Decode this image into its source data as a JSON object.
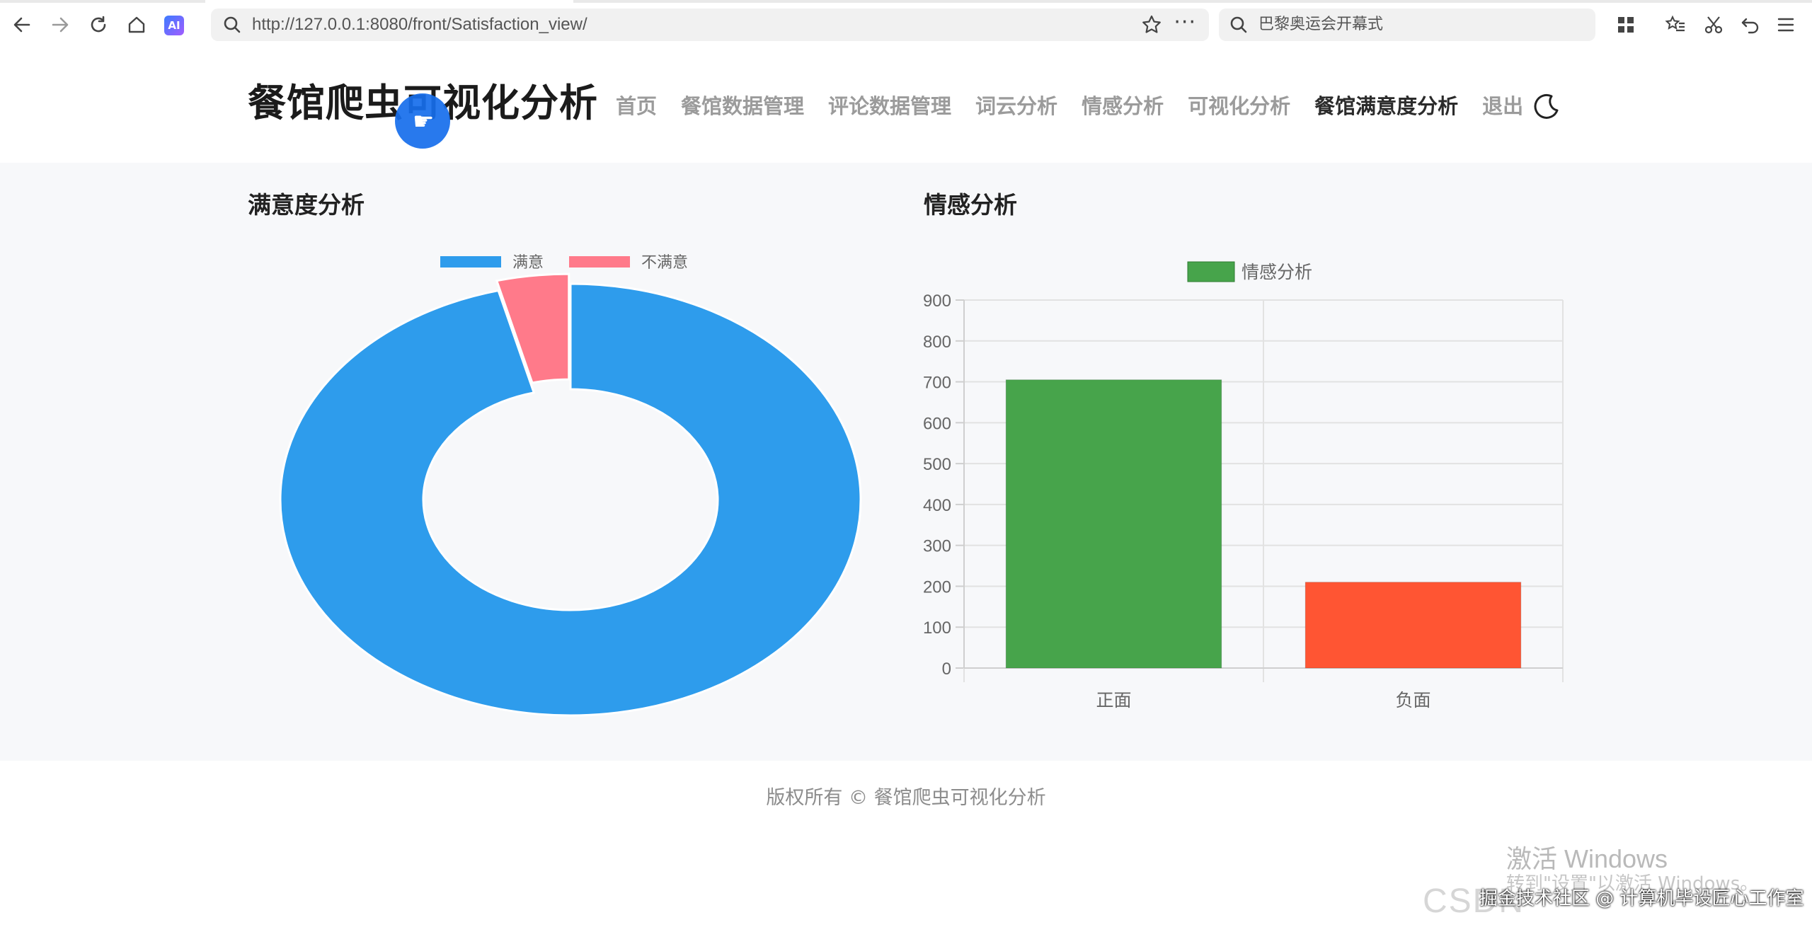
{
  "browser": {
    "address_url": "http://127.0.0.1:8080/front/Satisfaction_view/",
    "search_text": "巴黎奥运会开幕式",
    "ai_badge": "AI",
    "more_label": "···"
  },
  "header": {
    "title": "餐馆爬虫可视化分析",
    "nav": [
      {
        "label": "首页"
      },
      {
        "label": "餐馆数据管理"
      },
      {
        "label": "评论数据管理"
      },
      {
        "label": "词云分析"
      },
      {
        "label": "情感分析"
      },
      {
        "label": "可视化分析"
      },
      {
        "label": "餐馆满意度分析"
      },
      {
        "label": "退出"
      }
    ],
    "active_nav": "餐馆满意度分析"
  },
  "main": {
    "satisfaction_title": "满意度分析",
    "sentiment_title": "情感分析"
  },
  "chart_data": [
    {
      "type": "pie",
      "title": "满意度分析",
      "legend_position": "top",
      "categories": [
        "满意",
        "不满意"
      ],
      "values": [
        96,
        4
      ],
      "colors": [
        "#2e9cec",
        "#ff7a8a"
      ],
      "donut": true
    },
    {
      "type": "bar",
      "title": "情感分析",
      "legend_position": "top",
      "categories": [
        "正面",
        "负面"
      ],
      "series": [
        {
          "name": "情感分析",
          "values": [
            705,
            210
          ]
        }
      ],
      "bar_colors": [
        "#47a44b",
        "#ff5533"
      ],
      "legend_color": "#47a44b",
      "ylim": [
        0,
        900
      ],
      "yticks": [
        0,
        100,
        200,
        300,
        400,
        500,
        600,
        700,
        800,
        900
      ],
      "grid": true
    }
  ],
  "footer": {
    "copyright": "版权所有 © 餐馆爬虫可视化分析"
  },
  "overlay": {
    "activate_windows": "激活 Windows",
    "activate_hint": "转到\"设置\"以激活 Windows。",
    "csdn": "CSDN",
    "credit": "掘金技术社区 @ 计算机毕设匠心工作室"
  }
}
